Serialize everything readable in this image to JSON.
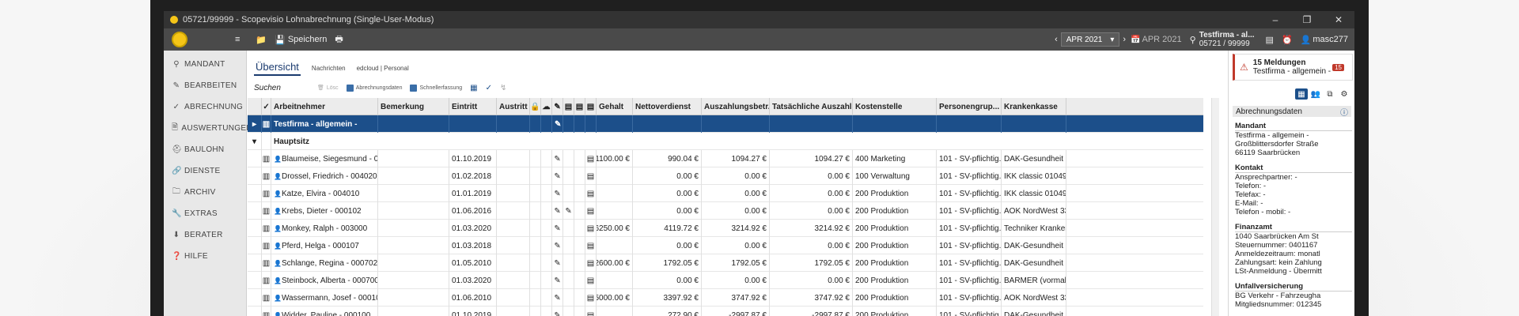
{
  "window": {
    "title": "05721/99999 - Scopevisio Lohnabrechnung (Single-User-Modus)"
  },
  "toolbar": {
    "save_label": "Speichern",
    "period": "APR 2021",
    "period_display": "APR 2021",
    "company_name": "Testfirma - al...",
    "company_number": "05721 / 99999",
    "user": "masc277"
  },
  "sidebar": {
    "items": [
      {
        "label": "MANDANT",
        "icon": "marker-icon"
      },
      {
        "label": "BEARBEITEN",
        "icon": "pencil-icon"
      },
      {
        "label": "ABRECHNUNG",
        "icon": "check-icon"
      },
      {
        "label": "AUSWERTUNGEN",
        "icon": "document-icon"
      },
      {
        "label": "BAULOHN",
        "icon": "helmet-icon"
      },
      {
        "label": "DIENSTE",
        "icon": "link-icon"
      },
      {
        "label": "ARCHIV",
        "icon": "folder-icon"
      },
      {
        "label": "EXTRAS",
        "icon": "wrench-icon"
      },
      {
        "label": "BERATER",
        "icon": "download-icon"
      },
      {
        "label": "HILFE",
        "icon": "help-icon"
      }
    ]
  },
  "tabs": {
    "active": "Übersicht",
    "t2": "Nachrichten",
    "t3": "edcloud | Personal"
  },
  "actions": {
    "search": "Suchen",
    "delete": "Lösc",
    "billing_data": "Abrechnungsdaten",
    "quick_entry": "Schnellerfassung"
  },
  "table": {
    "columns": [
      "Arbeitnehmer",
      "Bemerkung",
      "Eintritt",
      "Austritt",
      "Gehalt",
      "Nettoverdienst",
      "Auszahlungsbetr...",
      "Tatsächliche Auszahlung",
      "Kostenstelle",
      "Personengrup...",
      "Krankenkasse"
    ],
    "company_row": "Testfirma - allgemein -",
    "group_row": "Hauptsitz",
    "rows": [
      {
        "name": "Blaumeise, Siegesmund - 000200",
        "entry": "01.10.2019",
        "salary": "1100.00 €",
        "net": "990.04 €",
        "pay": "1094.27 €",
        "actual": "1094.27 €",
        "cost": "400 Marketing",
        "group": "101 - SV-pflichtig...",
        "kk": "DAK-Gesundheit 48698890 Ham..."
      },
      {
        "name": "Drossel, Friedrich - 004020",
        "entry": "01.02.2018",
        "salary": "",
        "net": "0.00 €",
        "pay": "0.00 €",
        "actual": "0.00 €",
        "cost": "100 Verwaltung",
        "group": "101 - SV-pflichtig...",
        "kk": "IKK classic 01049203 Dresden ..."
      },
      {
        "name": "Katze, Elvira - 004010",
        "entry": "01.01.2019",
        "salary": "",
        "net": "0.00 €",
        "pay": "0.00 €",
        "actual": "0.00 €",
        "cost": "200 Produktion",
        "group": "101 - SV-pflichtig...",
        "kk": "IKK classic 01049203 Dresden ..."
      },
      {
        "name": "Krebs, Dieter - 000102",
        "entry": "01.06.2016",
        "salary": "",
        "net": "0.00 €",
        "pay": "0.00 €",
        "actual": "0.00 €",
        "cost": "200 Produktion",
        "group": "101 - SV-pflichtig...",
        "kk": "AOK NordWest 33526082 Dortm..."
      },
      {
        "name": "Monkey, Ralph - 003000",
        "entry": "01.03.2020",
        "salary": "6250.00 €",
        "net": "4119.72 €",
        "pay": "3214.92 €",
        "actual": "3214.92 €",
        "cost": "200 Produktion",
        "group": "101 - SV-pflichtig...",
        "kk": "Techniker Krankenkasse Hambur..."
      },
      {
        "name": "Pferd, Helga - 000107",
        "entry": "01.03.2018",
        "salary": "",
        "net": "0.00 €",
        "pay": "0.00 €",
        "actual": "0.00 €",
        "cost": "200 Produktion",
        "group": "101 - SV-pflichtig...",
        "kk": "DAK-Gesundheit 48698890 Ham..."
      },
      {
        "name": "Schlange, Regina - 000702",
        "entry": "01.05.2010",
        "salary": "2600.00 €",
        "net": "1792.05 €",
        "pay": "1792.05 €",
        "actual": "1792.05 €",
        "cost": "200 Produktion",
        "group": "101 - SV-pflichtig...",
        "kk": "DAK-Gesundheit 48698890 Ham..."
      },
      {
        "name": "Steinbock, Alberta - 000700",
        "entry": "01.03.2020",
        "salary": "",
        "net": "0.00 €",
        "pay": "0.00 €",
        "actual": "0.00 €",
        "cost": "200 Produktion",
        "group": "101 - SV-pflichtig...",
        "kk": "BARMER (vormals BARMER GE..."
      },
      {
        "name": "Wassermann, Josef - 000101",
        "entry": "01.06.2010",
        "salary": "5000.00 €",
        "net": "3397.92 €",
        "pay": "3747.92 €",
        "actual": "3747.92 €",
        "cost": "200 Produktion",
        "group": "101 - SV-pflichtig...",
        "kk": "AOK NordWest 33526082 Dortm..."
      },
      {
        "name": "Widder, Pauline - 000100",
        "entry": "01.10.2019",
        "salary": "",
        "net": "272.90 €",
        "pay": "-2997.87 €",
        "actual": "-2997.87 €",
        "cost": "200 Produktion",
        "group": "101 - SV-pflichtig...",
        "kk": "DAK-Gesundheit 48698890 Ham..."
      }
    ]
  },
  "notification": {
    "title": "15 Meldungen",
    "subtitle": "Testfirma - allgemein -",
    "count": "15"
  },
  "panel": {
    "title": "Abrechnungsdaten",
    "mandant_h": "Mandant",
    "mandant": [
      "Testfirma - allgemein -",
      "Großblittersdorfer Straße",
      "66119 Saarbrücken"
    ],
    "kontakt_h": "Kontakt",
    "kontakt": [
      "Ansprechpartner: -",
      "Telefon: -",
      "Telefax: -",
      "E-Mail: -",
      "Telefon - mobil: -"
    ],
    "finanzamt_h": "Finanzamt",
    "finanzamt": [
      "1040 Saarbrücken Am St",
      "Steuernummer: 0401167",
      "Anmeldezeitraum: monatl",
      "Zahlungsart: kein Zahlung",
      "LSt-Anmeldung - Übermitt"
    ],
    "unfall_h": "Unfallversicherung",
    "unfall": [
      "BG Verkehr - Fahrzeugha",
      "Mitgliedsnummer: 012345"
    ]
  }
}
